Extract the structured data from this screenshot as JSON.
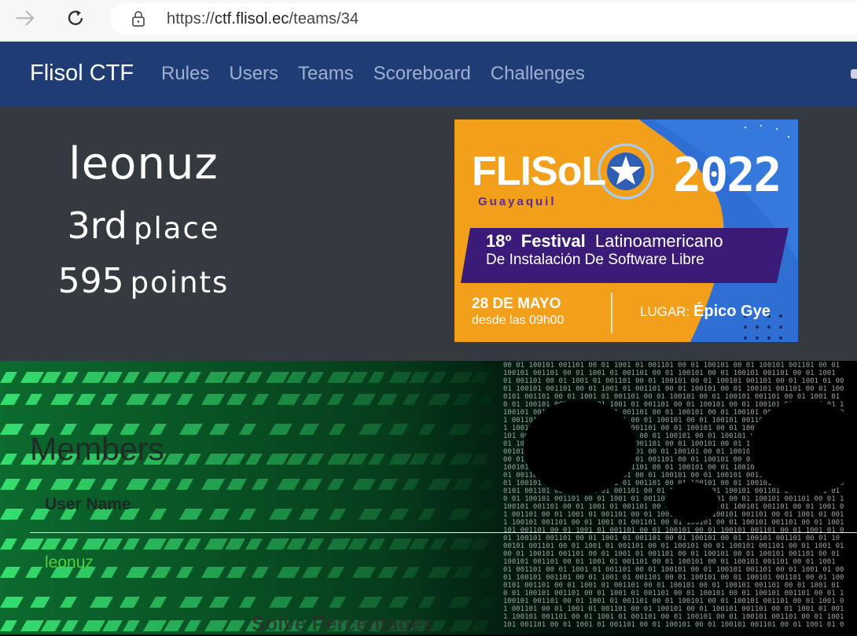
{
  "browser": {
    "url_prefix": "https://",
    "url_host": "ctf.flisol.ec",
    "url_path": "/teams/34"
  },
  "navbar": {
    "brand": "Flisol CTF",
    "links": [
      "Rules",
      "Users",
      "Teams",
      "Scoreboard",
      "Challenges"
    ]
  },
  "team": {
    "name": "leonuz",
    "place_number": "3rd",
    "place_word": "place",
    "points_number": "595",
    "points_word": "points"
  },
  "banner": {
    "logo": "FLISoL",
    "city": "Guayaquil",
    "year": "2022",
    "line1_a": "18º",
    "line1_b": "Festival",
    "line1_c": "Latinoamericano",
    "line2": "De Instalación De Software Libre",
    "date": "28 DE MAYO",
    "time": "desde las 09h00",
    "place_label": "LUGAR:",
    "place_value": "Épico Gye"
  },
  "members": {
    "heading": "Members",
    "column_header": "User Name",
    "rows": [
      {
        "name": "leonuz"
      }
    ]
  },
  "solve_heading": "Solve Percentages",
  "colors": {
    "navbar": "#1f3c75",
    "hero": "#343a40",
    "member_link": "#4fd03a",
    "banner_orange": "#f29f1b",
    "banner_purple": "#3a1c78",
    "banner_blue": "#2f6fd3"
  },
  "icons": [
    "back-arrow-icon",
    "reload-icon",
    "lock-icon"
  ]
}
